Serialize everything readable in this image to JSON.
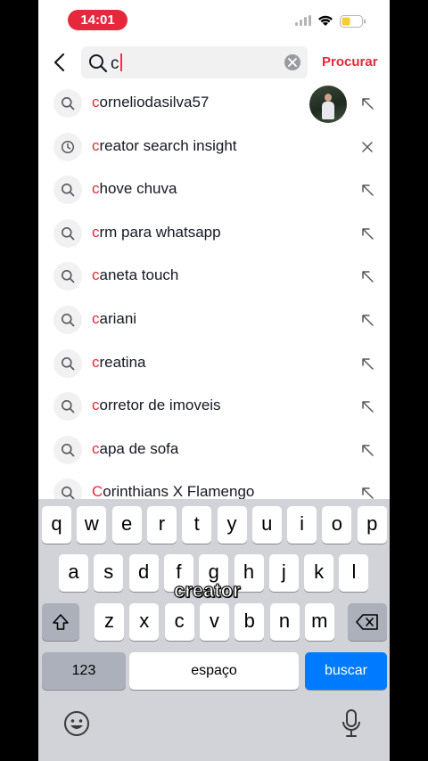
{
  "status_bar": {
    "time": "14:01"
  },
  "search": {
    "query": "c",
    "submit_label": "Procurar"
  },
  "suggestions": [
    {
      "hl": "c",
      "rest": "orneliodasilva57",
      "lead_icon": "search-icon",
      "action": "fill-arrow-icon",
      "has_avatar": true
    },
    {
      "hl": "c",
      "rest": "reator search insight",
      "lead_icon": "history-clock-icon",
      "action": "remove-icon",
      "has_avatar": false
    },
    {
      "hl": "c",
      "rest": "hove chuva",
      "lead_icon": "search-icon",
      "action": "fill-arrow-icon",
      "has_avatar": false
    },
    {
      "hl": "c",
      "rest": "rm para whatsapp",
      "lead_icon": "search-icon",
      "action": "fill-arrow-icon",
      "has_avatar": false
    },
    {
      "hl": "c",
      "rest": "aneta touch",
      "lead_icon": "search-icon",
      "action": "fill-arrow-icon",
      "has_avatar": false
    },
    {
      "hl": "c",
      "rest": "ariani",
      "lead_icon": "search-icon",
      "action": "fill-arrow-icon",
      "has_avatar": false
    },
    {
      "hl": "c",
      "rest": "reatina",
      "lead_icon": "search-icon",
      "action": "fill-arrow-icon",
      "has_avatar": false
    },
    {
      "hl": "c",
      "rest": "orretor de imoveis",
      "lead_icon": "search-icon",
      "action": "fill-arrow-icon",
      "has_avatar": false
    },
    {
      "hl": "c",
      "rest": "apa de sofa",
      "lead_icon": "search-icon",
      "action": "fill-arrow-icon",
      "has_avatar": false
    },
    {
      "hl": "C",
      "rest": "orinthians X Flamengo",
      "lead_icon": "search-icon",
      "action": "fill-arrow-icon",
      "has_avatar": false
    }
  ],
  "keyboard": {
    "row1": [
      "q",
      "w",
      "e",
      "r",
      "t",
      "y",
      "u",
      "i",
      "o",
      "p"
    ],
    "row2": [
      "a",
      "s",
      "d",
      "f",
      "g",
      "h",
      "j",
      "k",
      "l"
    ],
    "row3": [
      "z",
      "x",
      "c",
      "v",
      "b",
      "n",
      "m"
    ],
    "numbers_label": "123",
    "space_label": "espaço",
    "go_label": "buscar"
  },
  "caption_overlay": "creator",
  "colors": {
    "accent": "#e5283c",
    "keyboard_bg": "#d2d3d8",
    "go_key": "#007aff"
  }
}
